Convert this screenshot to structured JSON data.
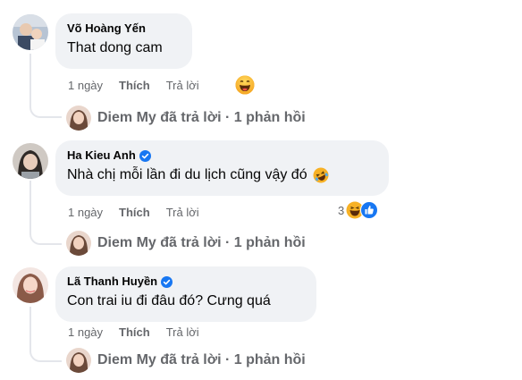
{
  "comments": [
    {
      "author": "Võ Hoàng Yến",
      "verified": false,
      "text": "That dong cam",
      "text_emoji": "",
      "time": "1 ngày",
      "like_label": "Thích",
      "reply_label": "Trả lời",
      "reaction_icon": "laughing-emoji-icon",
      "reaction_count": "",
      "reply_summary": "Diem My đã trả lời · 1 phản hồi"
    },
    {
      "author": "Ha Kieu Anh",
      "verified": true,
      "text": "Nhà chị mỗi lần đi du lịch cũng vậy đó",
      "text_emoji": "rolling-laughing-emoji-icon",
      "time": "1 ngày",
      "like_label": "Thích",
      "reply_label": "Trả lời",
      "reaction_icon": "haha-like-reactions-icon",
      "reaction_count": "3",
      "reply_summary": "Diem My đã trả lời · 1 phản hồi"
    },
    {
      "author": "Lã Thanh Huyền",
      "verified": true,
      "text": "Con trai iu đi đâu đó? Cưng quá",
      "text_emoji": "",
      "time": "1 ngày",
      "like_label": "Thích",
      "reply_label": "Trả lời",
      "reaction_icon": "",
      "reaction_count": "",
      "reply_summary": "Diem My đã trả lời · 1 phản hồi"
    }
  ],
  "colors": {
    "bubble": "#f0f2f5",
    "secondary_text": "#65676b",
    "verified_blue": "#1877f2",
    "thread_line": "#e4e6eb"
  }
}
